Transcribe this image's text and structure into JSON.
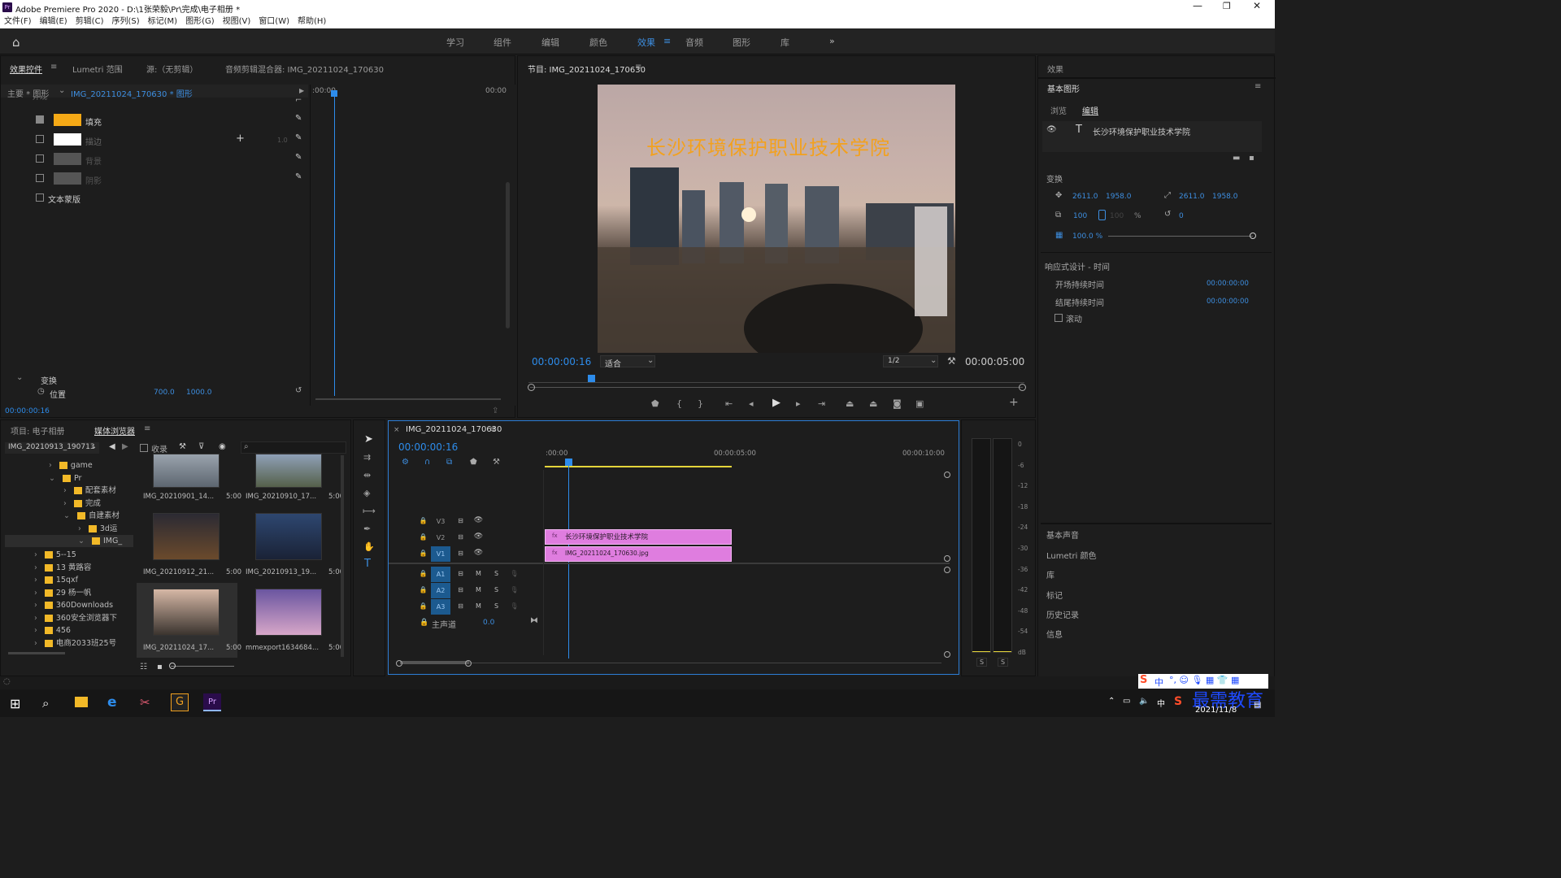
{
  "title_bar": {
    "text": "Adobe Premiere Pro 2020 - D:\\1张荣毅\\Pr\\完成\\电子相册 *",
    "app_icon": "Pr"
  },
  "menu": [
    "文件(F)",
    "编辑(E)",
    "剪辑(C)",
    "序列(S)",
    "标记(M)",
    "图形(G)",
    "视图(V)",
    "窗口(W)",
    "帮助(H)"
  ],
  "workspaces": [
    "学习",
    "组件",
    "编辑",
    "颜色",
    "效果",
    "音频",
    "图形",
    "库"
  ],
  "workspace_active": "效果",
  "effect_controls": {
    "tabs": [
      "效果控件",
      "Lumetri 范围",
      "源:（无剪辑）",
      "音频剪辑混合器: IMG_20211024_170630"
    ],
    "master": "主要 * 图形",
    "clip": "IMG_20211024_170630 * 图形",
    "tc_start": ":00:00",
    "tc_end": "00:00",
    "cut_label": "外观",
    "appearance": [
      {
        "label": "填充",
        "checked": true,
        "color": "#f5a916"
      },
      {
        "label": "描边",
        "checked": false,
        "color": "#ffffff",
        "value": "1.0"
      },
      {
        "label": "背景",
        "checked": false,
        "color": "#555555"
      },
      {
        "label": "阴影",
        "checked": false,
        "color": "#555555"
      }
    ],
    "text_mask": "文本蒙版",
    "transform_label": "变换",
    "position_label": "位置",
    "pos_x": "700.0",
    "pos_y": "1000.0",
    "timecode": "00:00:00:16"
  },
  "program": {
    "title": "节目: IMG_20211024_170630",
    "overlay_text": "长沙环境保护职业技术学院",
    "timecode": "00:00:00:16",
    "fit": "适合",
    "quality": "1/2",
    "duration": "00:00:05:00"
  },
  "right_panel": {
    "effects_label": "效果",
    "essential_graphics": "基本图形",
    "tabs": [
      "浏览",
      "编辑"
    ],
    "layer_text": "长沙环境保护职业技术学院",
    "transform_label": "变换",
    "pos_x": "2611.0",
    "pos_y": "1958.0",
    "anchor_x": "2611.0",
    "anchor_y": "1958.0",
    "scale": "100",
    "scale2": "100",
    "pct": "%",
    "rotation": "0",
    "opacity": "100.0 %",
    "responsive_label": "响应式设计 - 时间",
    "intro_label": "开场持续时间",
    "intro_value": "00:00:00:00",
    "outro_label": "结尾持续时间",
    "outro_value": "00:00:00:00",
    "roll_label": "滚动",
    "sections": [
      "基本声音",
      "Lumetri 颜色",
      "库",
      "标记",
      "历史记录",
      "信息"
    ]
  },
  "project": {
    "tabs": [
      "项目: 电子相册",
      "媒体浏览器"
    ],
    "folder_select": "IMG_20210913_190713",
    "bookmark": "收录",
    "tree": [
      {
        "label": "game",
        "indent": 1
      },
      {
        "label": "Pr",
        "indent": 1
      },
      {
        "label": "配套素材",
        "indent": 2
      },
      {
        "label": "完成",
        "indent": 2
      },
      {
        "label": "自建素材",
        "indent": 2
      },
      {
        "label": "3d运",
        "indent": 3
      },
      {
        "label": "IMG_",
        "indent": 3
      },
      {
        "label": "5--15",
        "indent": 0
      },
      {
        "label": "13 黄路容",
        "indent": 0
      },
      {
        "label": "15qxf",
        "indent": 0
      },
      {
        "label": "29 杨一帆",
        "indent": 0
      },
      {
        "label": "360Downloads",
        "indent": 0
      },
      {
        "label": "360安全浏览器下",
        "indent": 0
      },
      {
        "label": "456",
        "indent": 0
      },
      {
        "label": "电商2033班25号",
        "indent": 0
      }
    ],
    "thumbs": [
      {
        "name": "IMG_20210901_14...",
        "dur": "5:00",
        "colors": [
          "#9aa3ad",
          "#5d6670"
        ]
      },
      {
        "name": "IMG_20210910_17...",
        "dur": "5:00",
        "colors": [
          "#8fa0b7",
          "#55604a"
        ]
      },
      {
        "name": "IMG_20210912_21...",
        "dur": "5:00",
        "colors": [
          "#2b2a33",
          "#6b4a2c"
        ]
      },
      {
        "name": "IMG_20210913_19...",
        "dur": "5:00",
        "colors": [
          "#2e4770",
          "#1a2236"
        ]
      },
      {
        "name": "IMG_20211024_17...",
        "dur": "5:00",
        "colors": [
          "#d6b8a6",
          "#3b342f"
        ]
      },
      {
        "name": "mmexport1634684...",
        "dur": "5:00",
        "colors": [
          "#6a55a0",
          "#d7a6c8"
        ]
      }
    ]
  },
  "timeline": {
    "title": "IMG_20211024_170630",
    "timecode": "00:00:00:16",
    "ruler": [
      ":00:00",
      "00:00:05:00",
      "00:00:10:00"
    ],
    "tracks": [
      "V3",
      "V2",
      "V1",
      "A1",
      "A2",
      "A3"
    ],
    "master": "主声道",
    "master_value": "0.0",
    "clip_text": "长沙环境保护职业技术学院",
    "clip_img": "IMG_20211024_170630.jpg",
    "m": "M",
    "s": "S"
  },
  "meter": {
    "labels": [
      "0",
      "-6",
      "-12",
      "-18",
      "-24",
      "-30",
      "-36",
      "-42",
      "-48",
      "-54",
      "dB"
    ],
    "s": "S"
  },
  "taskbar": {
    "date": "2021/11/8",
    "watermark": "最需教育",
    "ime": "中"
  }
}
